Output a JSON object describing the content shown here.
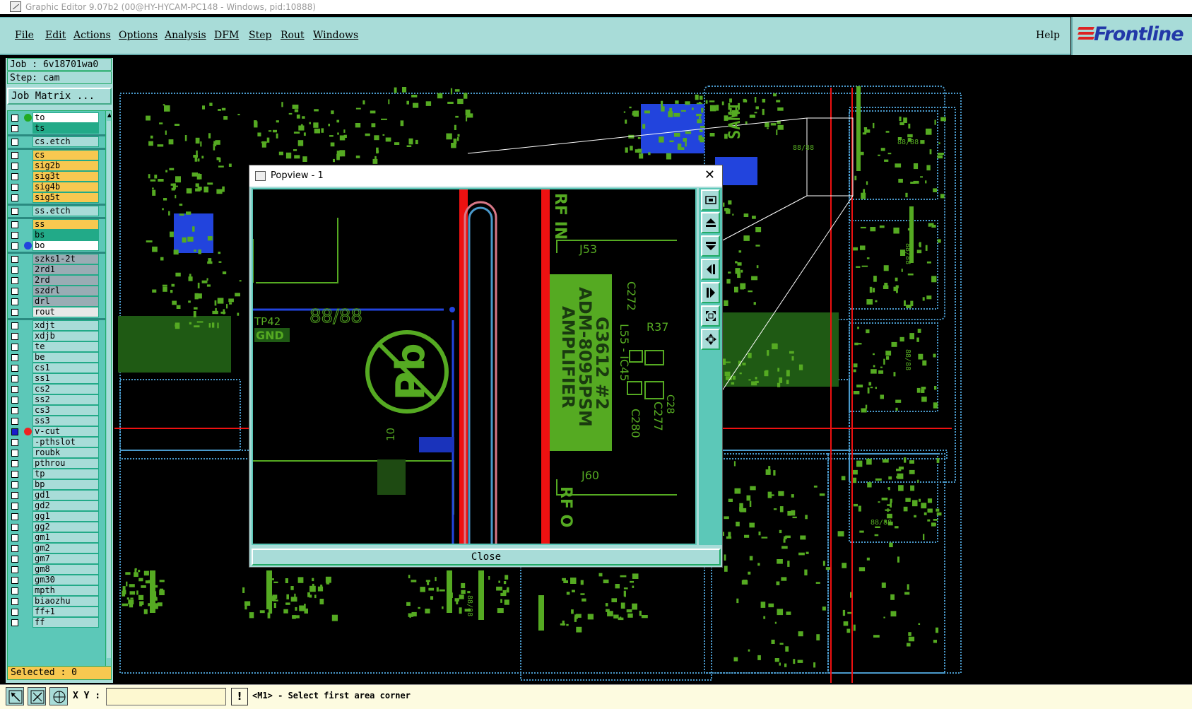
{
  "window": {
    "title": "Graphic Editor 9.07b2 (00@HY-HYCAM-PC148 - Windows, pid:10888)"
  },
  "menubar": {
    "items": [
      {
        "label": "File"
      },
      {
        "label": "Edit"
      },
      {
        "label": "Actions"
      },
      {
        "label": "Options"
      },
      {
        "label": "Analysis"
      },
      {
        "label": "DFM"
      },
      {
        "label": "Step"
      },
      {
        "label": "Rout"
      },
      {
        "label": "Windows"
      }
    ],
    "help": "Help",
    "logo": "Frontline"
  },
  "leftpanel": {
    "job": "Job : 6v18701wa0",
    "step": "Step: cam",
    "job_matrix": "Job Matrix ...",
    "layers": [
      {
        "name": "to",
        "color": "#ffffff",
        "dot": "#22aa22",
        "checked": false
      },
      {
        "name": "ts",
        "color": "#22aa88",
        "dot": "",
        "checked": false
      },
      {
        "name": "cs.etch",
        "color": "#a8dcd8",
        "dot": "",
        "checked": false
      },
      {
        "name": "cs",
        "color": "#f8c850",
        "dot": "",
        "checked": false
      },
      {
        "name": "sig2b",
        "color": "#f8c850",
        "dot": "",
        "checked": false
      },
      {
        "name": "sig3t",
        "color": "#f8c850",
        "dot": "",
        "checked": false
      },
      {
        "name": "sig4b",
        "color": "#f8c850",
        "dot": "",
        "checked": false
      },
      {
        "name": "sig5t",
        "color": "#f8c850",
        "dot": "",
        "checked": false
      },
      {
        "name": "ss.etch",
        "color": "#a8dcd8",
        "dot": "",
        "checked": false
      },
      {
        "name": "ss",
        "color": "#f8c850",
        "dot": "",
        "checked": false
      },
      {
        "name": "bs",
        "color": "#22aa88",
        "dot": "",
        "checked": false
      },
      {
        "name": "bo",
        "color": "#ffffff",
        "dot": "#2244dd",
        "checked": false
      },
      {
        "name": "szks1-2t",
        "color": "#9aacb4",
        "dot": "",
        "checked": false
      },
      {
        "name": "2rd1",
        "color": "#9aacb4",
        "dot": "",
        "checked": false
      },
      {
        "name": "2rd",
        "color": "#9aacb4",
        "dot": "",
        "checked": false
      },
      {
        "name": "szdrl",
        "color": "#9aacb4",
        "dot": "",
        "checked": false
      },
      {
        "name": "drl",
        "color": "#9aacb4",
        "dot": "",
        "checked": false
      },
      {
        "name": "rout",
        "color": "#e8e8e8",
        "dot": "",
        "checked": false
      },
      {
        "name": "xdjt",
        "color": "#a8dcd8",
        "dot": "",
        "checked": false
      },
      {
        "name": "xdjb",
        "color": "#a8dcd8",
        "dot": "",
        "checked": false
      },
      {
        "name": "te",
        "color": "#a8dcd8",
        "dot": "",
        "checked": false
      },
      {
        "name": "be",
        "color": "#a8dcd8",
        "dot": "",
        "checked": false
      },
      {
        "name": "cs1",
        "color": "#a8dcd8",
        "dot": "",
        "checked": false
      },
      {
        "name": "ss1",
        "color": "#a8dcd8",
        "dot": "",
        "checked": false
      },
      {
        "name": "cs2",
        "color": "#a8dcd8",
        "dot": "",
        "checked": false
      },
      {
        "name": "ss2",
        "color": "#a8dcd8",
        "dot": "",
        "checked": false
      },
      {
        "name": "cs3",
        "color": "#a8dcd8",
        "dot": "",
        "checked": false
      },
      {
        "name": "ss3",
        "color": "#a8dcd8",
        "dot": "",
        "checked": false
      },
      {
        "name": "v-cut",
        "color": "#a8dcd8",
        "dot": "#ee2222",
        "checked": true
      },
      {
        "name": "-pthslot",
        "color": "#a8dcd8",
        "dot": "",
        "checked": false
      },
      {
        "name": "roubk",
        "color": "#a8dcd8",
        "dot": "",
        "checked": false
      },
      {
        "name": "pthrou",
        "color": "#a8dcd8",
        "dot": "",
        "checked": false
      },
      {
        "name": "tp",
        "color": "#a8dcd8",
        "dot": "",
        "checked": false
      },
      {
        "name": "bp",
        "color": "#a8dcd8",
        "dot": "",
        "checked": false
      },
      {
        "name": "gd1",
        "color": "#a8dcd8",
        "dot": "",
        "checked": false
      },
      {
        "name": "gd2",
        "color": "#a8dcd8",
        "dot": "",
        "checked": false
      },
      {
        "name": "gg1",
        "color": "#a8dcd8",
        "dot": "",
        "checked": false
      },
      {
        "name": "gg2",
        "color": "#a8dcd8",
        "dot": "",
        "checked": false
      },
      {
        "name": "gm1",
        "color": "#a8dcd8",
        "dot": "",
        "checked": false
      },
      {
        "name": "gm2",
        "color": "#a8dcd8",
        "dot": "",
        "checked": false
      },
      {
        "name": "gm7",
        "color": "#a8dcd8",
        "dot": "",
        "checked": false
      },
      {
        "name": "gm8",
        "color": "#a8dcd8",
        "dot": "",
        "checked": false
      },
      {
        "name": "gm30",
        "color": "#a8dcd8",
        "dot": "",
        "checked": false
      },
      {
        "name": "mpth",
        "color": "#a8dcd8",
        "dot": "",
        "checked": false
      },
      {
        "name": "biaozhu",
        "color": "#a8dcd8",
        "dot": "",
        "checked": false
      },
      {
        "name": "ff+1",
        "color": "#a8dcd8",
        "dot": "",
        "checked": false
      },
      {
        "name": "ff",
        "color": "#a8dcd8",
        "dot": "",
        "checked": false
      }
    ],
    "selected": "Selected : 0"
  },
  "canvas": {
    "labels": [
      "88/88",
      "88/88",
      "88/88",
      "88/88",
      "88/88",
      "88/88",
      "SAMI"
    ]
  },
  "popview": {
    "title": "Popview - 1",
    "close_x": "✕",
    "close_button": "Close",
    "texts": {
      "rf_in": "RF IN",
      "j53": "J53",
      "c272": "C272",
      "r37": "R37",
      "tp42": "TP42",
      "gnd": "GND",
      "ic_label": "88/88",
      "chip_line1": "G3612 #2",
      "chip_line2": "ADM-8095PSM",
      "chip_line3": "AMPLIFIER",
      "l55": "L55 - IC45",
      "c277": "C277",
      "c280": "C280",
      "c298": "C28",
      "n10": "10",
      "j60": "J60",
      "rf_o": "RF O",
      "pb": "Pb"
    },
    "tools": [
      "zoom-fit-icon",
      "pan-up-icon",
      "pan-down-icon",
      "pan-left-icon",
      "pan-right-icon",
      "zoom-in-icon",
      "zoom-out-icon"
    ]
  },
  "statusbar": {
    "xy_label": "X Y :",
    "xy_value": "",
    "bang": "!",
    "prompt": "<M1> - Select first area corner"
  },
  "colors": {
    "panel": "#a8dcd8",
    "trace_green": "#55aa22",
    "pad_blue": "#2244dd",
    "vcut_red": "#ee1111",
    "outline_blue": "#4a9acc"
  }
}
